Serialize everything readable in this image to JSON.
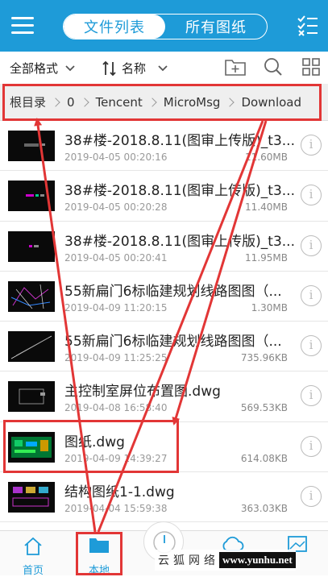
{
  "header": {
    "tabs": [
      {
        "label": "文件列表",
        "active": true
      },
      {
        "label": "所有图纸",
        "active": false
      }
    ]
  },
  "toolbar": {
    "format_label": "全部格式",
    "sort_label": "名称"
  },
  "breadcrumb": [
    "根目录",
    "0",
    "Tencent",
    "MicroMsg",
    "Download"
  ],
  "files": [
    {
      "name": "38#楼-2018.8.11(图审上传版)_t3...",
      "date": "2019-04-05 00:20:16",
      "size": "11.60MB"
    },
    {
      "name": "38#楼-2018.8.11(图审上传版)_t3...",
      "date": "2019-04-05 00:20:28",
      "size": "11.40MB"
    },
    {
      "name": "38#楼-2018.8.11(图审上传版)_t3...",
      "date": "2019-04-05 00:20:41",
      "size": "11.95MB"
    },
    {
      "name": "55新扁门6标临建规划线路图图（...",
      "date": "2019-04-09 11:20:15",
      "size": "1.30MB"
    },
    {
      "name": "55新扁门6标临建规划线路图图（...",
      "date": "2019-04-09 11:25:25",
      "size": "735.96KB"
    },
    {
      "name": "主控制室屏位布置图.dwg",
      "date": "2019-04-08 16:58:40",
      "size": "569.53KB"
    },
    {
      "name": "图纸.dwg",
      "date": "2019-04-09 14:39:27",
      "size": "614.08KB"
    },
    {
      "name": "结构图纸1-1.dwg",
      "date": "2019-04-04 15:59:38",
      "size": "363.03KB"
    }
  ],
  "bottom_nav": [
    {
      "label": "首页"
    },
    {
      "label": "本地"
    }
  ],
  "watermark": {
    "text": "云狐网络",
    "url": "www.yunhu.net"
  },
  "colors": {
    "accent": "#1e9bd8",
    "annotation": "#e23636"
  }
}
